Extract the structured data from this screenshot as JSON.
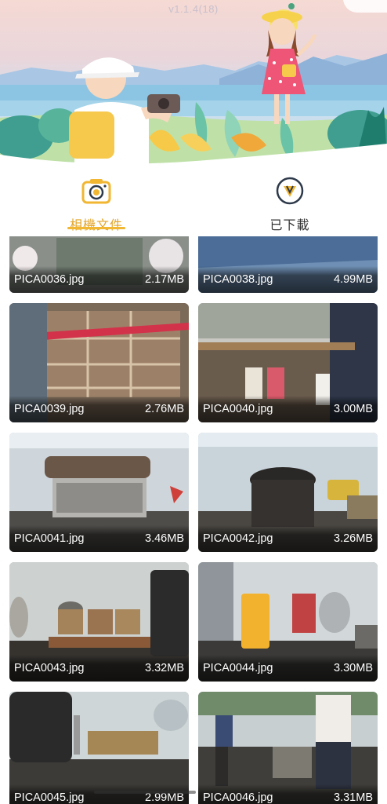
{
  "app": {
    "version": "v1.1.4(18)"
  },
  "tabs": [
    {
      "label": "相機文件",
      "icon": "camera-icon",
      "active": true
    },
    {
      "label": "已下載",
      "icon": "download-icon",
      "active": false
    }
  ],
  "colors": {
    "accent": "#f1b632",
    "active_label": "#e3a52a",
    "caption_text": "#ffffff"
  },
  "files": [
    {
      "name": "PICA0036.jpg",
      "size": "2.17MB"
    },
    {
      "name": "PICA0038.jpg",
      "size": "4.99MB"
    },
    {
      "name": "PICA0039.jpg",
      "size": "2.76MB"
    },
    {
      "name": "PICA0040.jpg",
      "size": "3.00MB"
    },
    {
      "name": "PICA0041.jpg",
      "size": "3.46MB"
    },
    {
      "name": "PICA0042.jpg",
      "size": "3.26MB"
    },
    {
      "name": "PICA0043.jpg",
      "size": "3.32MB"
    },
    {
      "name": "PICA0044.jpg",
      "size": "3.30MB"
    },
    {
      "name": "PICA0045.jpg",
      "size": "2.99MB"
    },
    {
      "name": "PICA0046.jpg",
      "size": "3.31MB"
    }
  ]
}
